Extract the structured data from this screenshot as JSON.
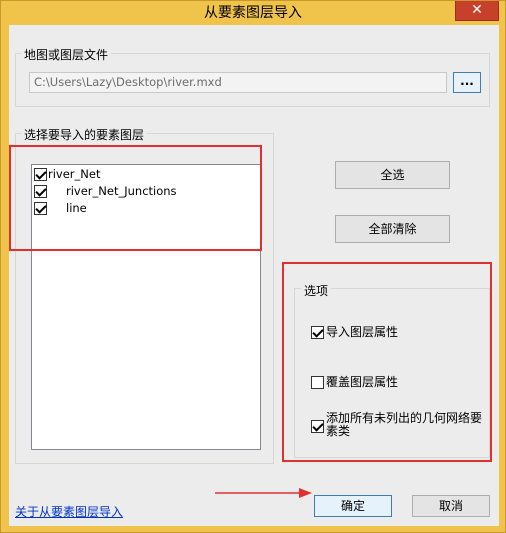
{
  "window": {
    "title": "从要素图层导入",
    "close_label": "✕"
  },
  "source": {
    "group_label": "地图或图层文件",
    "path_value": "C:\\Users\\Lazy\\Desktop\\river.mxd",
    "browse_label": "..."
  },
  "layers": {
    "group_label": "选择要导入的要素图层",
    "items": [
      {
        "label": "river_Net",
        "checked": true
      },
      {
        "label": "river_Net_Junctions",
        "checked": true
      },
      {
        "label": "line",
        "checked": true
      }
    ]
  },
  "buttons": {
    "select_all": "全选",
    "clear_all": "全部清除",
    "ok": "确定",
    "cancel": "取消"
  },
  "options": {
    "group_label": "选项",
    "import_layer_props": {
      "label": "导入图层属性",
      "checked": true
    },
    "override_layer_props": {
      "label": "覆盖图层属性",
      "checked": false
    },
    "add_unlisted": {
      "label": "添加所有未列出的几何网络要素类",
      "checked": true
    }
  },
  "footer": {
    "about_link": "关于从要素图层导入"
  },
  "colors": {
    "annotation_red": "#e23030",
    "link_blue": "#0033cc"
  }
}
